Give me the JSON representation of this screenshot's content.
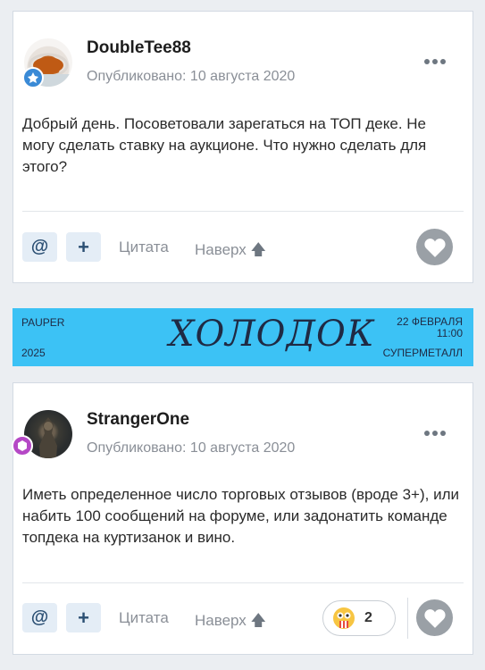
{
  "posts": [
    {
      "author": "DoubleTee88",
      "date": "Опубликовано: 10 августа 2020",
      "body": "Добрый день. Посоветовали зарегаться на ТОП деке. Не могу сделать ставку на аукционе. Что нужно сделать для этого?",
      "badge_color": "#3a8ad6"
    },
    {
      "author": "StrangerOne",
      "date": "Опубликовано: 10 августа 2020",
      "body": "Иметь определенное число торговых отзывов (вроде 3+), или набить 100 сообщений на форуме, или задонатить команде топдека на куртизанок и вино.",
      "badge_color": "#b548c6",
      "reaction_count": "2"
    }
  ],
  "actions": {
    "mention": "@",
    "plus": "+",
    "quote": "Цитата",
    "top": "Наверх"
  },
  "banner": {
    "top_left": "PAUPER",
    "bottom_left": "2025",
    "script_title": "ХОЛОДОК",
    "top_right_line1": "22 ФЕВРАЛЯ",
    "top_right_line2": "11:00",
    "bottom_right": "СУПЕРМЕТАЛЛ",
    "bg_color": "#3cc2f5"
  }
}
